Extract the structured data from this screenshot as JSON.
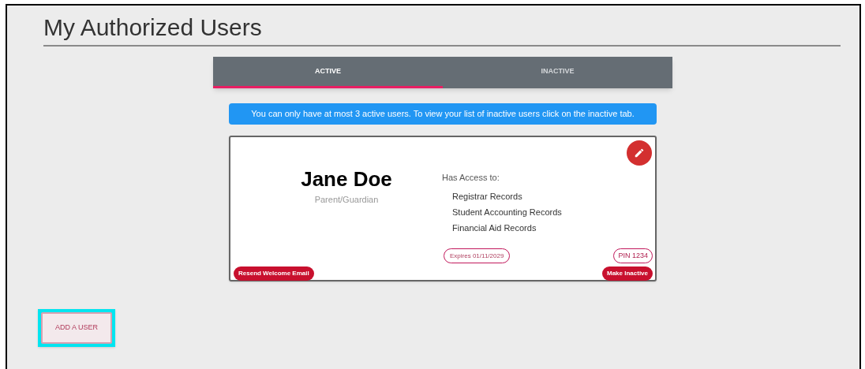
{
  "title": "My Authorized Users",
  "tabs": [
    {
      "label": "ACTIVE",
      "selected": true
    },
    {
      "label": "INACTIVE",
      "selected": false
    }
  ],
  "notice": "You can only have at most 3 active users. To view your list of inactive users click on the inactive tab.",
  "user": {
    "name": "Jane Doe",
    "role": "Parent/Guardian",
    "access_heading": "Has Access to:",
    "access": [
      "Registrar Records",
      "Student Accounting Records",
      "Financial Aid Records"
    ],
    "expires": "Expires 01/11/2029",
    "pin": "PIN 1234",
    "resend_button": "Resend Welcome Email",
    "inactive_button": "Make Inactive"
  },
  "add_button": {
    "label": "ADD A USER",
    "focused": true
  }
}
